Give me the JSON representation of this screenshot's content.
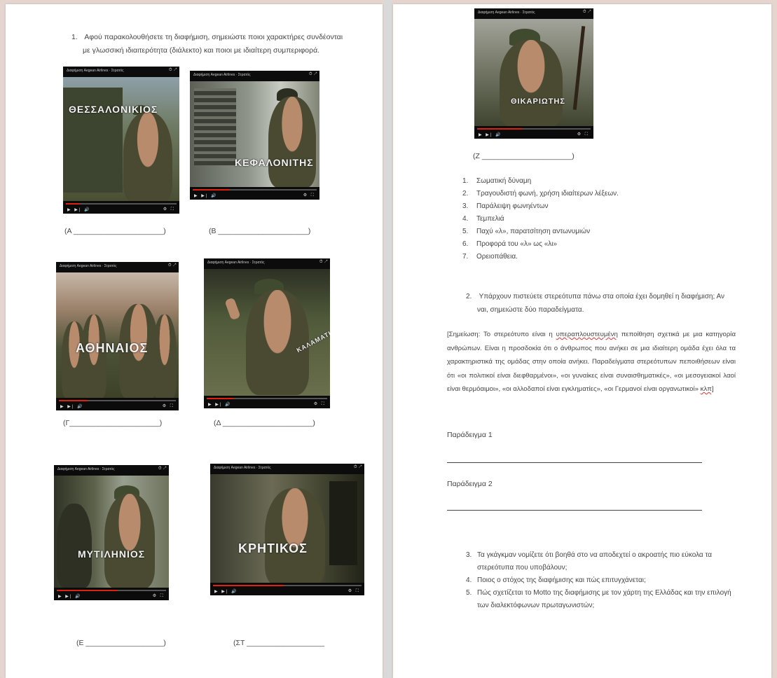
{
  "left_page": {
    "question1_number": "1.",
    "question1_line1": "Αφού παρακολουθήσετε τη διαφήμιση, σημειώστε ποιοι χαρακτήρες συνδέονται",
    "question1_line2": "με γλωσσική ιδιαιτερότητα (διάλεκτο) και ποιοι με ιδιαίτερη συμπεριφορά.",
    "video_title": "Διαφήμιση Aegean Airlines · Στρατός",
    "thumbnails": [
      {
        "caption": "ΘΕΣΣΑΛΟΝΙΚΙΟΣ",
        "blank": "(Α ______________________)"
      },
      {
        "caption": "ΚΕΦΑΛΟΝΙΤΗΣ",
        "blank": "(Β ______________________)"
      },
      {
        "caption": "ΑΘΗΝΑΙΟΣ",
        "blank": "(Γ______________________)"
      },
      {
        "caption": "ΚΑΛΑΜΑΤΙΑΝΟΣ",
        "blank": "(Δ ______________________)"
      },
      {
        "caption": "ΜΥΤΙΛΗΝΙΟΣ",
        "blank": "(Ε ___________________)"
      },
      {
        "caption": "ΚΡΗΤΙΚΟΣ",
        "blank": "(ΣΤ ___________________"
      }
    ]
  },
  "right_page": {
    "thumbnail": {
      "caption": "ΘΙΚΑΡΙΩΤΗΣ",
      "blank": "(Ζ ______________________)"
    },
    "features": [
      {
        "n": "1.",
        "text": "Σωματική δύναμη"
      },
      {
        "n": "2.",
        "text": "Τραγουδιστή φωνή, χρήση ιδιαίτερων λέξεων."
      },
      {
        "n": "3.",
        "text": "Παράλειψη φωνηέντων"
      },
      {
        "n": "4.",
        "text": "Τεμπελιά"
      },
      {
        "n": "5.",
        "text": "Παχύ «λ», παρατσίτηση αντωνυμιών"
      },
      {
        "n": "6.",
        "text": "Προφορά του «λ» ως «λι»"
      },
      {
        "n": "7.",
        "text": "Ορειοπάθεια."
      }
    ],
    "question2_number": "2.",
    "question2_line1": "Υπάρχουν πιστεύετε στερεότυπα πάνω στα οποία έχει δομηθεί η διαφήμιση; Αν",
    "question2_line2": "ναι, σημειώστε δύο παραδείγματα.",
    "note_part1": "[Σημείωση: Το στερεότυπο είναι η ",
    "note_underlined": "υπεραπλουστευμένη",
    "note_part2": " πεποίθηση σχετικά με μια κατηγορία ανθρώπων. Είναι η προσδοκία ότι ο άνθρωπος που ανήκει σε μια ιδιαίτερη ομάδα έχει όλα τα χαρακτηριστικά της ομάδας στην οποία ανήκει. Παραδείγματα στερεότυπων πεποιθήσεων είναι ότι «οι πολιτικοί είναι διεφθαρμένοι», «οι γυναίκες είναι συναισθηματικές», «οι μεσογειακοί λαοί είναι θερμόαιμοι», «οι αλλοδαποί είναι εγκληματίες», «οι Γερμανοί είναι οργανωτικοί» ",
    "note_end": "κλπ]",
    "example1": "Παράδειγμα 1",
    "example2": "Παράδειγμα 2",
    "questions_rest": [
      {
        "n": "3.",
        "line1": "Τα γκάγκμαν νομίζετε ότι βοηθά στο να αποδεχτεί ο ακροατής πιο εύκολα τα",
        "line2": "στερεότυπα που υποβάλουν;"
      },
      {
        "n": "4.",
        "line1": "Ποιος ο στόχος της διαφήμισης και πώς επιτυγχάνεται;",
        "line2": ""
      },
      {
        "n": "5.",
        "line1": "Πώς σχετίζεται το Motto της διαφήμισης με τον χάρτη της Ελλάδας και την επιλογή",
        "line2": "των διαλεκτόφωνων πρωταγωνιστών;"
      }
    ]
  }
}
